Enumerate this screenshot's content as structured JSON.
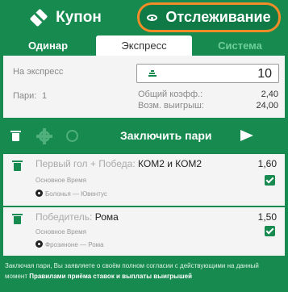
{
  "header": {
    "coupon_label": "Купон",
    "tracking_label": "Отслеживание"
  },
  "bet_types": {
    "single": "Одинар",
    "express": "Экспресс",
    "system": "Система"
  },
  "summary": {
    "express_label": "На экспресс",
    "stake_value": "10",
    "pairs_label": "Пари:",
    "pairs_count": "1",
    "total_coeff_label": "Общий коэфф.:",
    "total_coeff_value": "2,40",
    "possible_win_label": "Возм. выигрыш:",
    "possible_win_value": "24,00"
  },
  "actions": {
    "place_bet_label": "Заключить пари"
  },
  "bets": [
    {
      "market": "Первый гол + Победа:",
      "selection": "КОМ2 и КОМ2",
      "odds": "1,60",
      "period": "Основное Время",
      "teams": "Болонья — Ювентус",
      "checked": true
    },
    {
      "market": "Победитель:",
      "selection": "Рома",
      "odds": "1,50",
      "period": "Основное Время",
      "teams": "Фрозиноне — Рома",
      "checked": true
    }
  ],
  "footer": {
    "text": "Заключая пари, Вы заявляете о своём полном согласии с действующими на данный момент",
    "rules_link": "Правилами приёма ставок и выплаты выигрышей"
  },
  "colors": {
    "brand_green": "#178a4f",
    "highlight_orange": "#f28c28"
  }
}
